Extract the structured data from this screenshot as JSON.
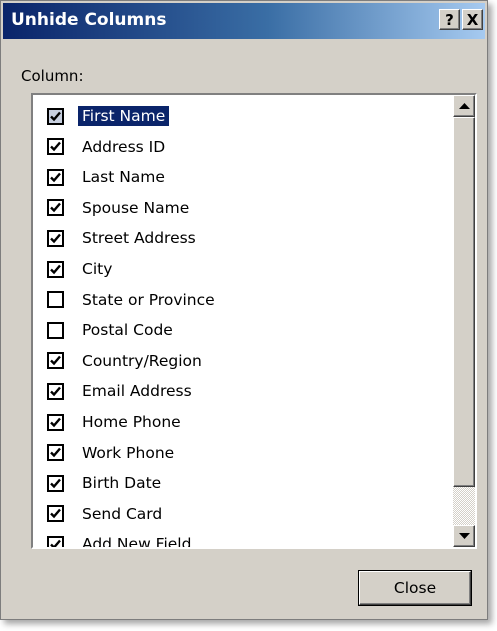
{
  "dialog": {
    "title": "Unhide Columns",
    "help_glyph": "?",
    "close_glyph": "X",
    "column_label": "Column:",
    "close_button_label": "Close"
  },
  "columns": [
    {
      "label": "First Name",
      "checked": true,
      "selected": true
    },
    {
      "label": "Address ID",
      "checked": true
    },
    {
      "label": "Last Name",
      "checked": true
    },
    {
      "label": "Spouse Name",
      "checked": true
    },
    {
      "label": "Street Address",
      "checked": true
    },
    {
      "label": "City",
      "checked": true
    },
    {
      "label": "State or Province",
      "checked": false
    },
    {
      "label": "Postal Code",
      "checked": false
    },
    {
      "label": "Country/Region",
      "checked": true
    },
    {
      "label": "Email Address",
      "checked": true
    },
    {
      "label": "Home Phone",
      "checked": true
    },
    {
      "label": "Work Phone",
      "checked": true
    },
    {
      "label": "Birth Date",
      "checked": true
    },
    {
      "label": "Send Card",
      "checked": true
    },
    {
      "label": "Add New Field",
      "checked": true
    }
  ],
  "colors": {
    "title_bar_start": "#0a246a",
    "title_bar_end": "#a6caf0",
    "selection": "#0a246a",
    "dialog_face": "#d4d0c8"
  },
  "icons": {
    "help": "help-icon",
    "close": "close-icon",
    "scroll_up": "arrow-up-icon",
    "scroll_down": "arrow-down-icon",
    "checkmark": "checkmark-icon"
  }
}
